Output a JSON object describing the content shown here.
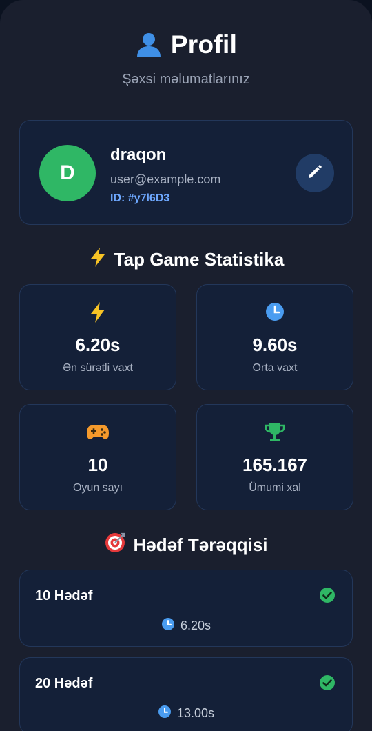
{
  "header": {
    "title": "Profil",
    "subtitle": "Şəxsi məlumatlarınız",
    "icon": "user-icon"
  },
  "profile": {
    "avatar_letter": "D",
    "avatar_color": "#2fb765",
    "name": "draqon",
    "email": "user@example.com",
    "id_text": "ID: #y7l6D3",
    "edit_icon": "pencil-icon"
  },
  "stats_section": {
    "title": "Tap Game Statistika",
    "icon": "lightning-icon"
  },
  "stats": [
    {
      "icon": "lightning-icon",
      "value": "6.20s",
      "label": "Ən sürətli vaxt"
    },
    {
      "icon": "clock-icon",
      "value": "9.60s",
      "label": "Orta vaxt"
    },
    {
      "icon": "gamepad-icon",
      "value": "10",
      "label": "Oyun sayı"
    },
    {
      "icon": "trophy-icon",
      "value": "165.167",
      "label": "Ümumi xal"
    }
  ],
  "goals_section": {
    "title": "Hədəf Tərəqqisi",
    "icon": "target-icon"
  },
  "goals": [
    {
      "title": "10 Hədəf",
      "time": "6.20s",
      "completed": true
    },
    {
      "title": "20 Hədəf",
      "time": "13.00s",
      "completed": true
    }
  ],
  "colors": {
    "accent_blue": "#6ea8ff",
    "success_green": "#2fb765",
    "background": "#1a1f2e",
    "card": "#142038"
  }
}
